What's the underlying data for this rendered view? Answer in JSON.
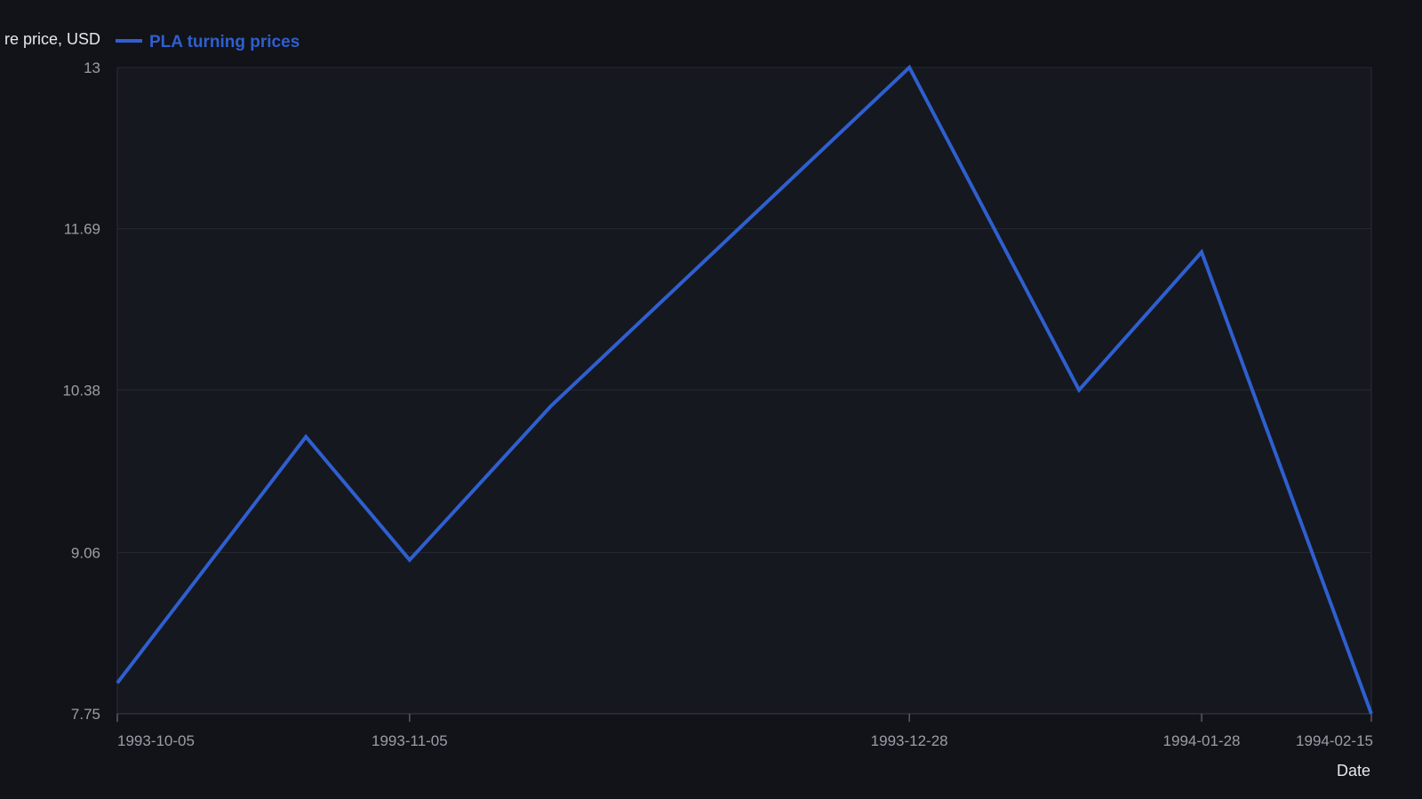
{
  "chart_data": {
    "type": "line",
    "title": "",
    "xlabel": "Date",
    "ylabel": "re price, USD",
    "x_ticks": [
      "1993-10-05",
      "1993-11-05",
      "1993-12-28",
      "1994-01-28",
      "1994-02-15"
    ],
    "y_ticks": [
      "7.75",
      "9.06",
      "10.38",
      "11.69",
      "13"
    ],
    "xlim": [
      "1993-10-05",
      "1994-02-15"
    ],
    "ylim": [
      7.75,
      13
    ],
    "grid": true,
    "legend_position": "top-left",
    "series": [
      {
        "name": "PLA turning prices",
        "color": "#2f5fd0",
        "points": [
          {
            "x": "1993-10-05",
            "y": 8.0
          },
          {
            "x": "1993-10-25",
            "y": 10.0
          },
          {
            "x": "1993-11-05",
            "y": 9.0
          },
          {
            "x": "1993-11-20",
            "y": 10.25
          },
          {
            "x": "1993-12-28",
            "y": 13.0
          },
          {
            "x": "1994-01-15",
            "y": 10.38
          },
          {
            "x": "1994-01-28",
            "y": 11.5
          },
          {
            "x": "1994-02-15",
            "y": 7.75
          }
        ]
      }
    ]
  }
}
